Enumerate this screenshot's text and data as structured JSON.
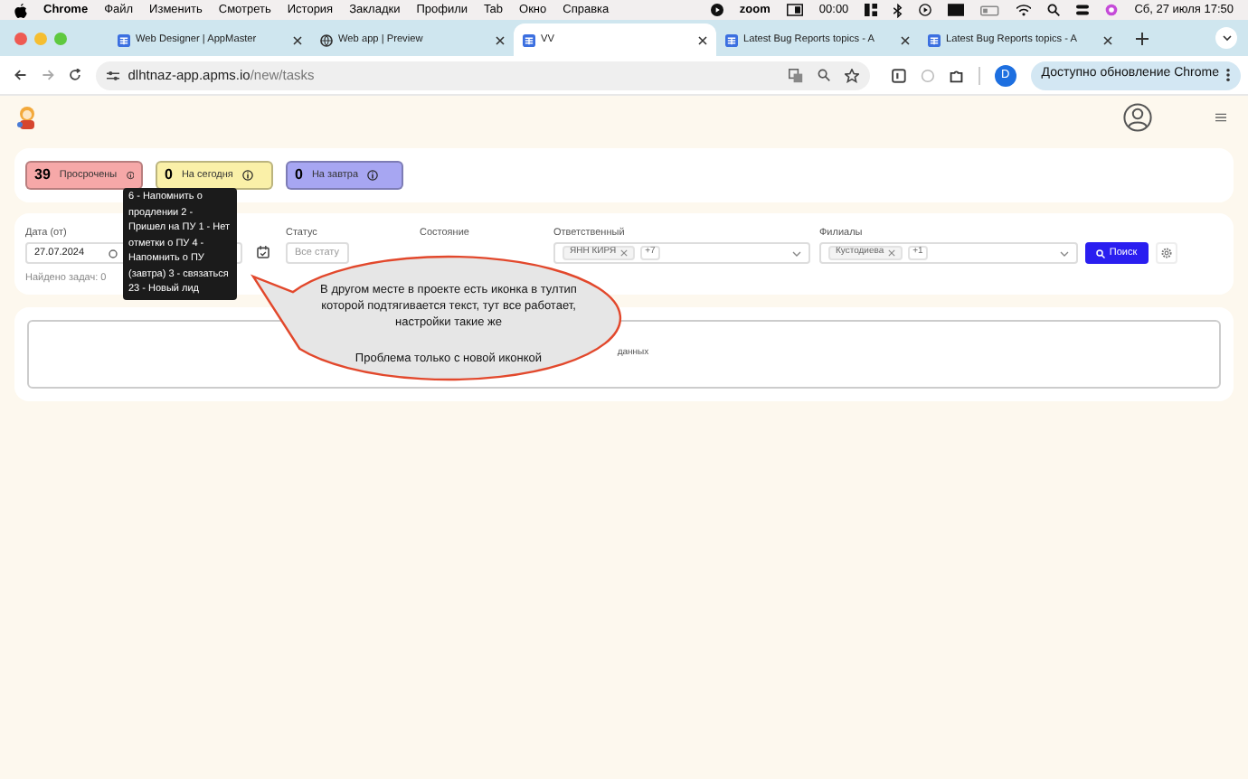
{
  "menu_bar": {
    "app": "Chrome",
    "items": [
      "Файл",
      "Изменить",
      "Смотреть",
      "История",
      "Закладки",
      "Профили",
      "Tab",
      "Окно",
      "Справка"
    ],
    "zoom": "zoom",
    "timer": "00:00",
    "clock": "Сб, 27 июля  17:50"
  },
  "tabs": [
    {
      "title": "Web Designer | AppMaster",
      "kind": "app",
      "selected": false
    },
    {
      "title": "Web app | Preview",
      "kind": "globe",
      "selected": false
    },
    {
      "title": "VV",
      "kind": "app",
      "selected": true
    },
    {
      "title": "Latest Bug Reports topics - A",
      "kind": "app",
      "selected": false
    },
    {
      "title": "Latest Bug Reports topics - A",
      "kind": "app",
      "selected": false
    }
  ],
  "address_bar": {
    "host": "dlhtnaz-app.apms.io",
    "path": "/new/tasks"
  },
  "profile_initial": "D",
  "update_button": "Доступно обновление Chrome",
  "counters": [
    {
      "count": "39",
      "label": "Просрочены",
      "color": "#f6a8a8"
    },
    {
      "count": "0",
      "label": "На сегодня",
      "color": "#faf0a8"
    },
    {
      "count": "0",
      "label": "На завтра",
      "color": "#a7a6f2"
    }
  ],
  "tooltip": "6 - Напомнить о продлении 2 - Пришел на ПУ 1 - Нет отметки о ПУ 4 - Напомнить о ПУ (завтра) 3 - связаться 23 - Новый лид",
  "filters": {
    "date_from": {
      "label": "Дата (от)",
      "value": "27.07.2024"
    },
    "status": {
      "label": "Статус",
      "placeholder": "Все стату"
    },
    "state": {
      "label": "Состояние"
    },
    "responsible": {
      "label": "Ответственный",
      "chips": [
        "ЯНН КИРЯ"
      ],
      "more": "+7"
    },
    "branches": {
      "label": "Филиалы",
      "chips": [
        "Кустодиева"
      ],
      "more": "+1"
    },
    "search_button": "Поиск",
    "found": "Найдено задач: 0"
  },
  "results": {
    "empty_text": "данных"
  },
  "callout": {
    "text": "В другом месте в проекте есть иконка в тултип которой подтягивается текст, тут все работает, настройки такие же",
    "note": "Проблема только с новой иконкой"
  }
}
